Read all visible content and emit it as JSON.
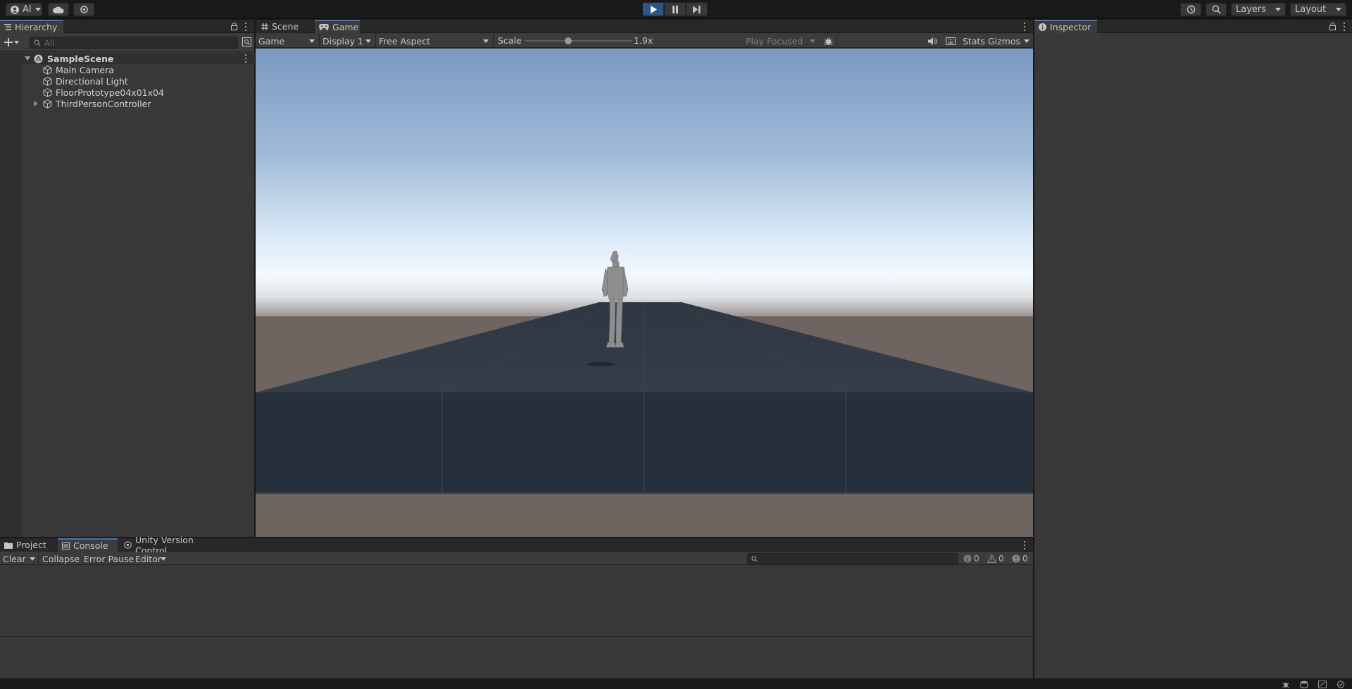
{
  "toolbar": {
    "account_label": "AI",
    "layers_label": "Layers",
    "layout_label": "Layout"
  },
  "hierarchy": {
    "tab_label": "Hierarchy",
    "search_placeholder": "All",
    "scene_name": "SampleScene",
    "items": [
      {
        "label": "Main Camera",
        "icon": "gameobject-cube-icon",
        "expandable": false
      },
      {
        "label": "Directional Light",
        "icon": "gameobject-cube-icon",
        "expandable": false
      },
      {
        "label": "FloorPrototype04x01x04",
        "icon": "gameobject-cube-icon",
        "expandable": false
      },
      {
        "label": "ThirdPersonController",
        "icon": "gameobject-cube-icon",
        "expandable": true
      }
    ]
  },
  "game_view": {
    "tabs": [
      {
        "label": "Scene",
        "icon": "grid-icon",
        "selected": false
      },
      {
        "label": "Game",
        "icon": "gamepad-icon",
        "selected": true
      }
    ],
    "view_dropdown": "Game",
    "display_dropdown": "Display 1",
    "aspect_dropdown": "Free Aspect",
    "scale_label": "Scale",
    "scale_value": "1.9x",
    "scale_fraction": 0.4,
    "play_mode_dropdown": "Play Focused",
    "stats_label": "Stats",
    "gizmos_label": "Gizmos"
  },
  "inspector": {
    "tab_label": "Inspector"
  },
  "console": {
    "tabs": [
      {
        "label": "Project",
        "icon": "folder-icon",
        "selected": false
      },
      {
        "label": "Console",
        "icon": "console-icon",
        "selected": true
      },
      {
        "label": "Unity Version Control",
        "icon": "version-control-icon",
        "selected": false
      }
    ],
    "clear_label": "Clear",
    "collapse_label": "Collapse",
    "error_pause_label": "Error Pause",
    "editor_label": "Editor",
    "info_count": "0",
    "warning_count": "0",
    "error_count": "0"
  },
  "colors": {
    "accent": "#3a79bb",
    "play_active": "#2a5785",
    "panel_bg": "#383838",
    "sky_top": "#7b99c2",
    "sky_horizon": "#f2f8ff",
    "ground": "#6e6460",
    "floor_top": "#333d47",
    "floor_front": "#25303b"
  }
}
